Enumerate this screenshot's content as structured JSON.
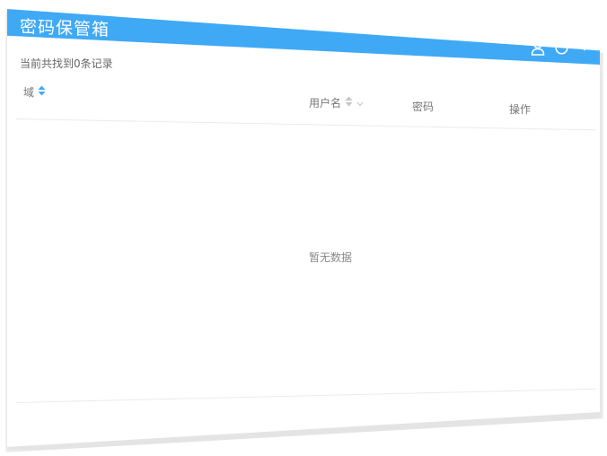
{
  "header": {
    "title": "密码保管箱",
    "icons": [
      "user-icon",
      "power-icon",
      "chevron-down-icon"
    ],
    "bg_color": "#3fa9f5"
  },
  "summary": {
    "record_count_text": "当前共找到0条记录"
  },
  "table": {
    "columns": [
      {
        "label": "域",
        "sort_icon": "sort-icon"
      },
      {
        "label": "用户名",
        "sort_icon": "sort-icon",
        "filter_icon": "chevron-down-icon"
      },
      {
        "label": "密码"
      },
      {
        "label": "操作"
      }
    ],
    "rows": [],
    "empty_text": "暂无数据"
  }
}
